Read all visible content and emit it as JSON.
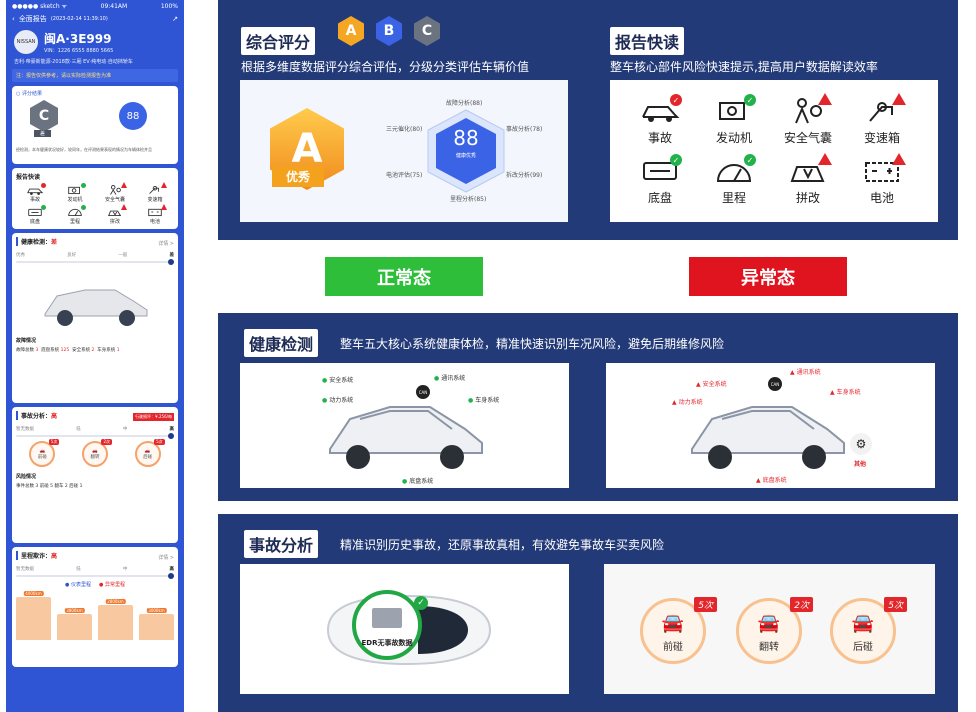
{
  "phone": {
    "status_carrier": "●●●●● sketch ᯤ",
    "status_time": "09:41AM",
    "status_battery": "100%",
    "back": "‹",
    "nav_title": "全面报告",
    "nav_date": "(2023-02-14 11:39:10)",
    "brand": "NISSAN",
    "plate": "闽A·3E999",
    "vin": "VIN：1226 6555 8880 5665",
    "meta": "吉利·帝豪新能源·2018款·三厢 EV·纯电动·自动挡轿车",
    "warn": "注：报告仅供参考，请以实际检测报告为准",
    "score_title": "○ 评分结果",
    "score_grade": "C",
    "score_grade_label": "差",
    "score_value": "88",
    "score_desc": "经检测，本车健康状况较好，较同年，在评测结果表现的情况为车辆体检并且",
    "quick_title": "报告快读",
    "quick_items": [
      "事故",
      "发动机",
      "安全气囊",
      "变速箱",
      "底盘",
      "里程",
      "拼改",
      "电池"
    ],
    "health_title": "健康检测：",
    "health_value": "差",
    "more": "详情 >",
    "health_steps": [
      "优秀",
      "良好",
      "一般",
      "差"
    ],
    "fault_title": "故障情况",
    "fault_line_prefix": "故障总数",
    "fault_total": "3",
    "fault_items": [
      {
        "label": "底盘系统",
        "value": "125"
      },
      {
        "label": "安全系统",
        "value": "2"
      },
      {
        "label": "车身系统",
        "value": "1"
      }
    ],
    "accident_title": "事故分析：",
    "accident_value": "高",
    "accident_tag": "行驶损坏：¥.256/每",
    "accident_steps": [
      "暂无数据",
      "低",
      "中",
      "高"
    ],
    "accident_circles": [
      {
        "label": "前碰",
        "count": "5次"
      },
      {
        "label": "翻转",
        "count": "2次"
      },
      {
        "label": "后碰",
        "count": "5次"
      }
    ],
    "risk_title": "风险情况",
    "risk_line": "事件总数 3  前碰 5  翻车 2  后碰 1",
    "mileage_title": "里程欺诈：",
    "mileage_value": "高",
    "legend_a": "● 仪表里程",
    "legend_b": "● 异常里程",
    "mileage_bars": [
      "4000km",
      "3800km",
      "2800km",
      "3000km"
    ]
  },
  "overall": {
    "tag": "综合评分",
    "badges": [
      "A",
      "B",
      "C"
    ],
    "desc": "根据多维度数据评分综合评估，分级分类评估车辆价值",
    "big_grade": "A",
    "big_grade_label": "优秀",
    "radar_labels": [
      "故障分析(88)",
      "事故分析(78)",
      "拆改分析(99)",
      "里程分析(85)",
      "电池评估(75)",
      "三元催化(80)"
    ],
    "radar_score": "88",
    "radar_score_label": "健康优秀"
  },
  "quick": {
    "tag": "报告快读",
    "desc": "整车核心部件风险快速提示,提高用户数据解读效率",
    "items": [
      {
        "label": "事故",
        "state": "bad-dot"
      },
      {
        "label": "发动机",
        "state": "ok"
      },
      {
        "label": "安全气囊",
        "state": "bad"
      },
      {
        "label": "变速箱",
        "state": "bad"
      },
      {
        "label": "底盘",
        "state": "ok"
      },
      {
        "label": "里程",
        "state": "ok"
      },
      {
        "label": "拼改",
        "state": "bad"
      },
      {
        "label": "电池",
        "state": "bad"
      }
    ]
  },
  "states": {
    "normal": "正常态",
    "abnormal": "异常态",
    "normal_color": "#2ebe3a",
    "abnormal_color": "#e0141e"
  },
  "health": {
    "tag": "健康检测",
    "desc": "整车五大核心系统健康体检，精准快速识别车况风险，避免后期维修风险",
    "normal_systems": [
      "安全系统",
      "通讯系统",
      "动力系统",
      "车身系统",
      "底盘系统"
    ],
    "abnormal_systems": [
      "安全系统",
      "通讯系统",
      "动力系统",
      "车身系统",
      "底盘系统"
    ],
    "can": "CAN",
    "mod": "其他"
  },
  "accident": {
    "tag": "事故分析",
    "desc": "精准识别历史事故，还原事故真相，有效避免事故车买卖风险",
    "edr": "EDR无事故数据",
    "circles": [
      {
        "label": "前碰",
        "count": "5次"
      },
      {
        "label": "翻转",
        "count": "2次"
      },
      {
        "label": "后碰",
        "count": "5次"
      }
    ]
  }
}
